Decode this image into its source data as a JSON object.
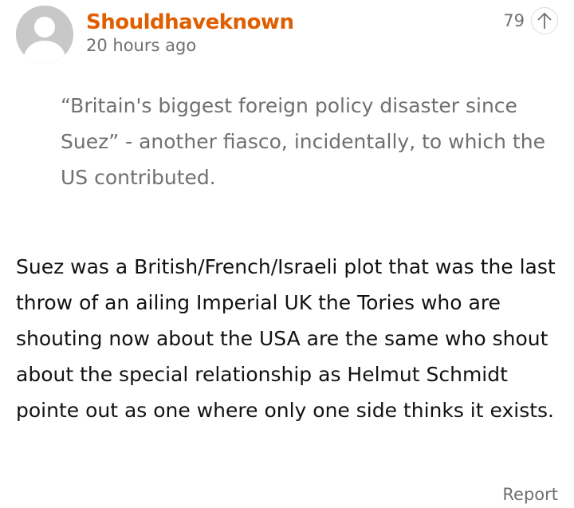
{
  "comment": {
    "author": "Shouldhaveknown",
    "timestamp": "20 hours ago",
    "recommend_count": "79",
    "quote": "“Britain's biggest foreign policy disaster since Suez” - another fiasco, incidentally, to which the US contributed.",
    "body": "Suez was a British/French/Israeli plot that was the last throw of an ailing Imperial UK the Tories who are shouting now about the USA are the same who shout about the special relationship as Helmut Schmidt pointe out as one where only one side thinks it exists.",
    "report_label": "Report"
  },
  "colors": {
    "author": "#e05e00",
    "muted": "#707070",
    "text": "#121212",
    "avatar_bg": "#c8c8c8"
  },
  "icons": {
    "avatar": "default-avatar-icon",
    "upvote": "arrow-up-icon"
  }
}
